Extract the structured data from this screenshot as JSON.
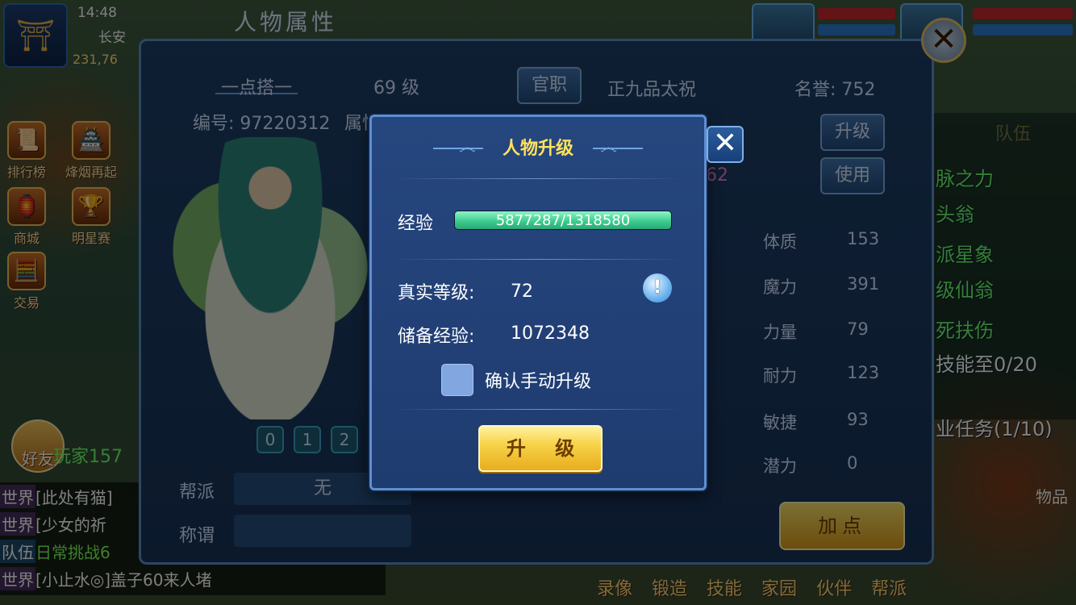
{
  "hud": {
    "time": "14:48",
    "location": "长安",
    "coords": "231,76",
    "left_menu": [
      "排行榜",
      "烽烟再起",
      "商城",
      "明星赛",
      "交易"
    ],
    "friends_label": "好友",
    "player_label": "玩家157",
    "items_label": "物品"
  },
  "right_tasks": {
    "team_tab": "队伍",
    "lines": [
      "脉之力",
      "头翁",
      "派星象",
      "级仙翁",
      "死扶伤",
      "技能至0/20",
      "业任务(1/10)"
    ]
  },
  "bottom_menu": [
    "录像",
    "锻造",
    "技能",
    "家园",
    "伙伴",
    "帮派"
  ],
  "chat": [
    {
      "channel": "世界",
      "message": "[此处有猫]"
    },
    {
      "channel": "世界",
      "message": "[少女的祈"
    },
    {
      "channel": "队伍",
      "message": "日常挑战6"
    },
    {
      "channel": "世界",
      "message": "[小止水◎]盖子60来人堵"
    }
  ],
  "character_panel": {
    "title": "人物属性",
    "name": "一点搭一",
    "level": "69 级",
    "id_label": "编号: 97220312",
    "attr_tab": "属性",
    "office_button": "官职",
    "rank": "正九品太祝",
    "honor": "名誉: 752",
    "upgrade_button": "升级",
    "use_button": "使用",
    "partial_value": "62",
    "stats": [
      {
        "label": "体质",
        "value": "153"
      },
      {
        "label": "魔力",
        "value": "391"
      },
      {
        "label": "力量",
        "value": "79"
      },
      {
        "label": "耐力",
        "value": "123"
      },
      {
        "label": "敏捷",
        "value": "93"
      },
      {
        "label": "潜力",
        "value": "0"
      }
    ],
    "tabs": [
      "0",
      "1",
      "2"
    ],
    "guild_label": "帮派",
    "guild_value": "无",
    "title_label": "称谓",
    "title_value": "",
    "add_point_button": "加点"
  },
  "dialog": {
    "title": "人物升级",
    "exp_label": "经验",
    "exp_text": "5877287/1318580",
    "exp_fill": 1.0,
    "real_level_label": "真实等级:",
    "real_level": "72",
    "reserve_exp_label": "储备经验:",
    "reserve_exp": "1072348",
    "confirm_label": "确认手动升级",
    "upgrade_button": "升 级",
    "close_symbol": "✕"
  },
  "colors": {
    "dialog_bg": "#26467f",
    "title_yellow": "#ffe35a",
    "exp_green": "#39c98c",
    "button_gold": "#f7d34a"
  }
}
